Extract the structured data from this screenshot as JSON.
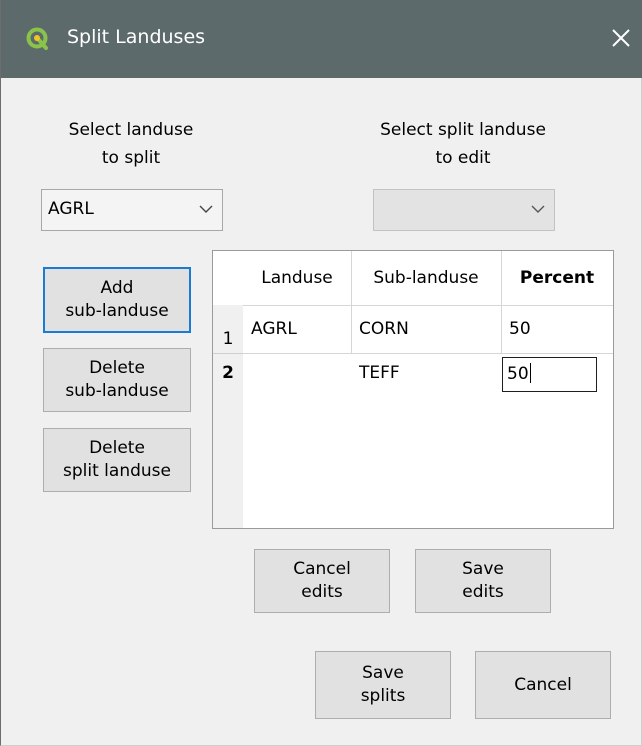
{
  "window": {
    "title": "Split Landuses"
  },
  "left_section": {
    "label_line1": "Select landuse",
    "label_line2": "to split",
    "selected_value": "AGRL"
  },
  "right_section": {
    "label_line1": "Select split landuse",
    "label_line2": "to edit",
    "selected_value": ""
  },
  "side_buttons": {
    "add": {
      "line1": "Add",
      "line2": "sub-landuse"
    },
    "delete_sub": {
      "line1": "Delete",
      "line2": "sub-landuse"
    },
    "delete_split": {
      "line1": "Delete",
      "line2": "split landuse"
    }
  },
  "table": {
    "columns": [
      "Landuse",
      "Sub-landuse",
      "Percent"
    ],
    "rows": [
      {
        "row_label": "1",
        "landuse": "AGRL",
        "sub_landuse": "CORN",
        "percent": "50"
      },
      {
        "row_label": "2",
        "landuse": "",
        "sub_landuse": "TEFF",
        "percent": "50"
      }
    ]
  },
  "edit_buttons": {
    "cancel": {
      "line1": "Cancel",
      "line2": "edits"
    },
    "save": {
      "line1": "Save",
      "line2": "edits"
    }
  },
  "footer_buttons": {
    "save_splits": {
      "line1": "Save",
      "line2": "splits"
    },
    "cancel": {
      "label": "Cancel"
    }
  },
  "colors": {
    "titlebar": "#5c6a6c",
    "focus_border": "#1a7bd4",
    "dialog_bg": "#f0f0f0"
  },
  "icons": {
    "app": "qgis-logo-icon",
    "close": "close-icon",
    "dropdown": "chevron-down-icon"
  }
}
